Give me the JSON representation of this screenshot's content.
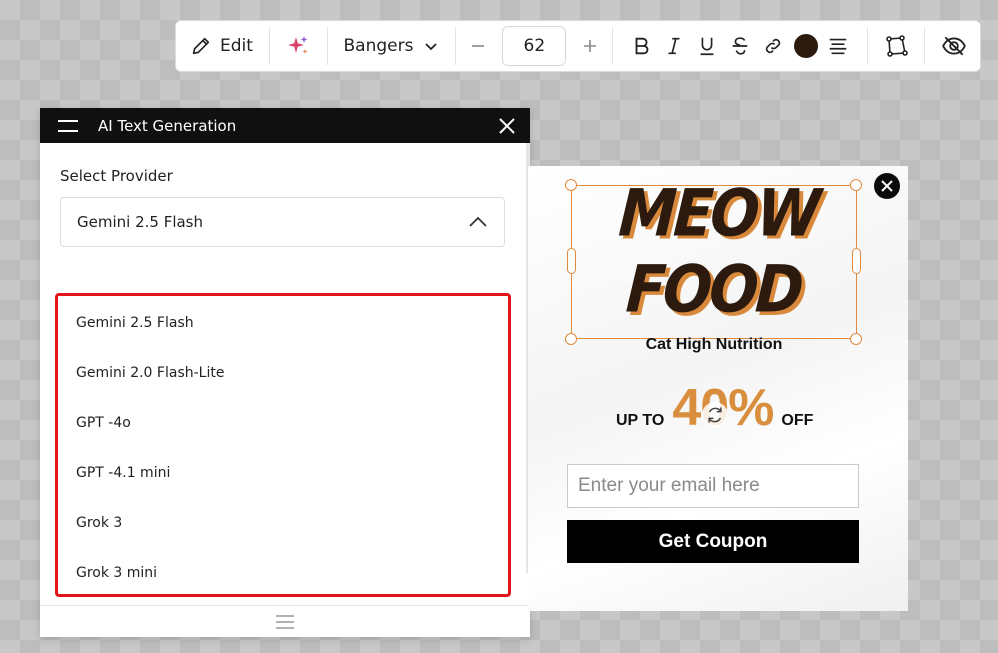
{
  "toolbar": {
    "edit_label": "Edit",
    "font_name": "Bangers",
    "font_size": "62",
    "text_color": "#2c1a0e",
    "icons": [
      "pencil-icon",
      "sparkle-icon",
      "chevron-down-icon",
      "minus-icon",
      "plus-icon",
      "bold-icon",
      "italic-icon",
      "underline-icon",
      "strikethrough-icon",
      "link-icon",
      "align-center-icon",
      "shape-icon",
      "eye-off-icon"
    ]
  },
  "panel": {
    "title": "AI Text Generation",
    "provider_label": "Select Provider",
    "selected_provider": "Gemini 2.5 Flash",
    "options": [
      "Gemini 2.5 Flash",
      "Gemini 2.0 Flash-Lite",
      "GPT -4o",
      "GPT -4.1 mini",
      "Grok 3",
      "Grok 3 mini"
    ],
    "highlight_color": "#e4141b"
  },
  "popup": {
    "headline_line1": "MEOW",
    "headline_line2": "FOOD",
    "subhead": "Cat High Nutrition",
    "upto": "UP TO",
    "percent": "40%",
    "off": "OFF",
    "email_placeholder": "Enter your email here",
    "button_label": "Get Coupon",
    "accent_color": "#d88e3c"
  }
}
